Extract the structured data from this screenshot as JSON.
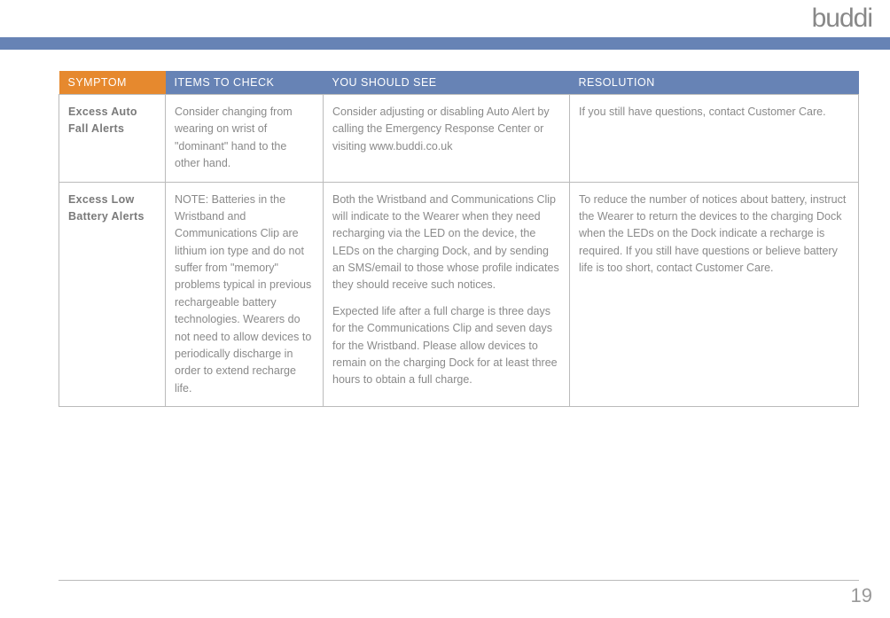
{
  "brand": "buddi",
  "page_number": "19",
  "table": {
    "headers": {
      "symptom": "SYMPTOM",
      "items": "ITEMS TO CHECK",
      "see": "YOU SHOULD SEE",
      "resolution": "RESOLUTION"
    },
    "rows": [
      {
        "symptom": "Excess Auto Fall Alerts",
        "items": "Consider changing from wearing on wrist of \"dominant\" hand to the other hand.",
        "see": "Consider adjusting or disabling Auto Alert by calling the Emergency Response Center or visiting www.buddi.co.uk",
        "resolution": "If you still have questions, contact Customer Care."
      },
      {
        "symptom": "Excess Low Battery Alerts",
        "items": "NOTE: Batteries in the Wristband and Communications Clip are lithium ion type and do not suffer from \"memory\" problems typical in previous rechargeable battery technologies. Wearers do not need to allow devices to periodically discharge in order to extend recharge life.",
        "see_p1": "Both the Wristband and Communications Clip will indicate to the Wearer when they need recharging via the LED on the device, the LEDs on the charging Dock, and by sending an SMS/email to those whose profile indicates they should receive such notices.",
        "see_p2": "Expected life after a full charge is three days for the Communications Clip and seven days for the Wristband. Please allow devices to remain on the charging Dock for at least three hours to obtain a full charge.",
        "resolution": "To reduce the number of notices about battery, instruct the Wearer to return the devices to the charging Dock when the LEDs on the Dock indicate a recharge is required. If you still have questions or believe battery life is too short, contact Customer Care."
      }
    ]
  }
}
